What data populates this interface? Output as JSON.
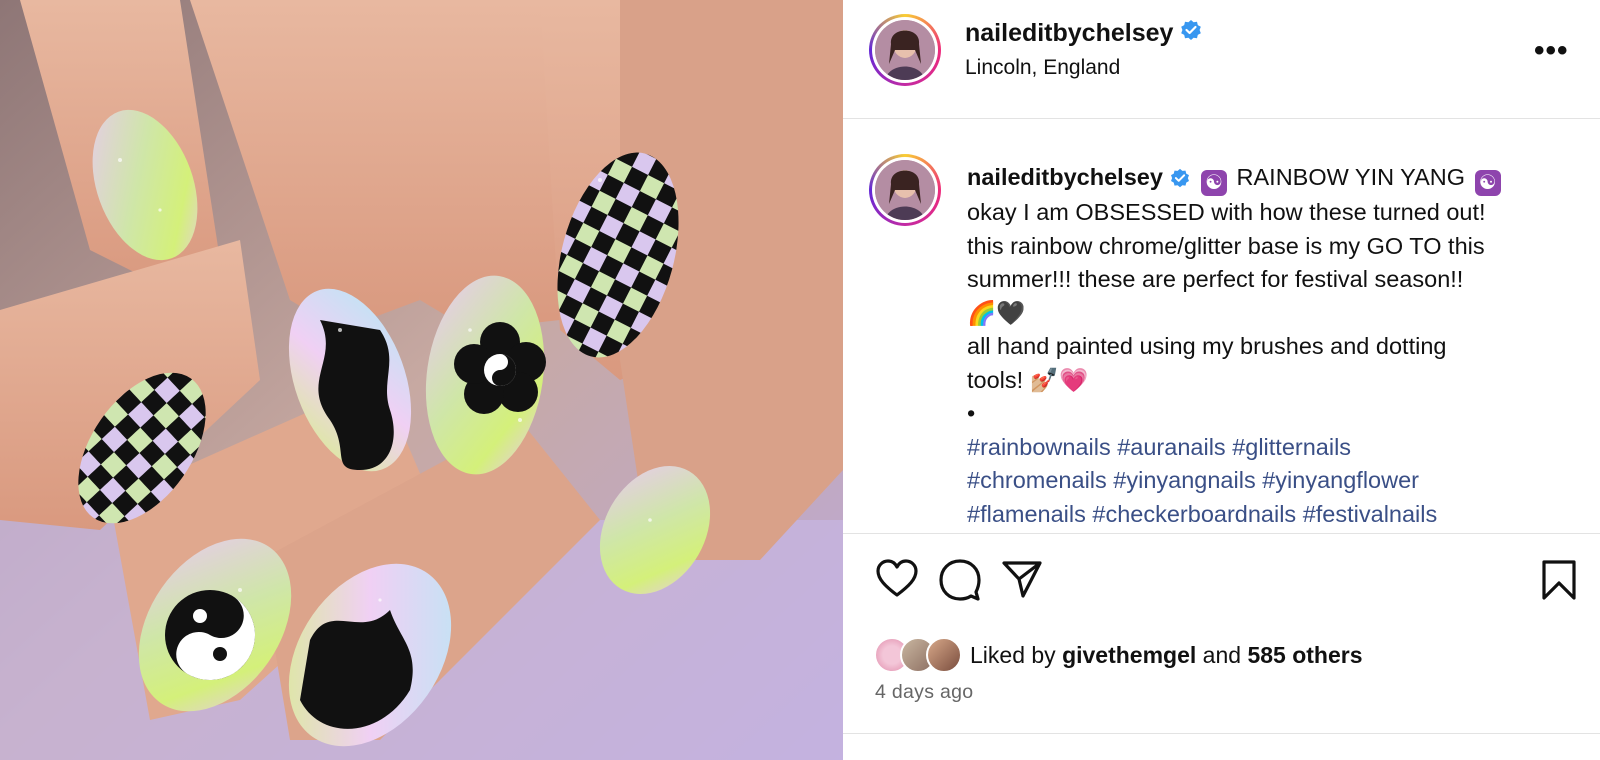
{
  "post": {
    "username": "naileditbychelsey",
    "location": "Lincoln, England",
    "more_label": "•••"
  },
  "caption": {
    "title": "RAINBOW YIN YANG",
    "title_emoji": "☯",
    "line1": "okay I am OBSESSED with how these turned out!",
    "line2": "this rainbow chrome/glitter base is my GO TO this",
    "line3": "summer!!! these are perfect for festival season!!",
    "line3_emoji": "🌈🖤",
    "line4": "all hand painted using my brushes and dotting",
    "line5": "tools!",
    "line5_emoji": "💅🏼💗",
    "bullet": "•",
    "hashtags_line1": "#rainbownails #auranails #glitternails",
    "hashtags_line2": "#chromenails #yinyangnails #yinyangflower",
    "hashtags_line3": "#flamenails #checkerboardnails #festivalnails"
  },
  "likes": {
    "prefix": "Liked by",
    "liked_by_user": "givethemgel",
    "and_label": "and",
    "others": "585 others"
  },
  "timestamp": "4 days ago",
  "colors": {
    "verified": "#3897f0",
    "hashtag": "#3a4f86",
    "divider": "#e3e3e3"
  },
  "icons": [
    "heart-icon",
    "comment-icon",
    "share-icon",
    "bookmark-icon",
    "verified-badge-icon",
    "more-options-icon"
  ]
}
